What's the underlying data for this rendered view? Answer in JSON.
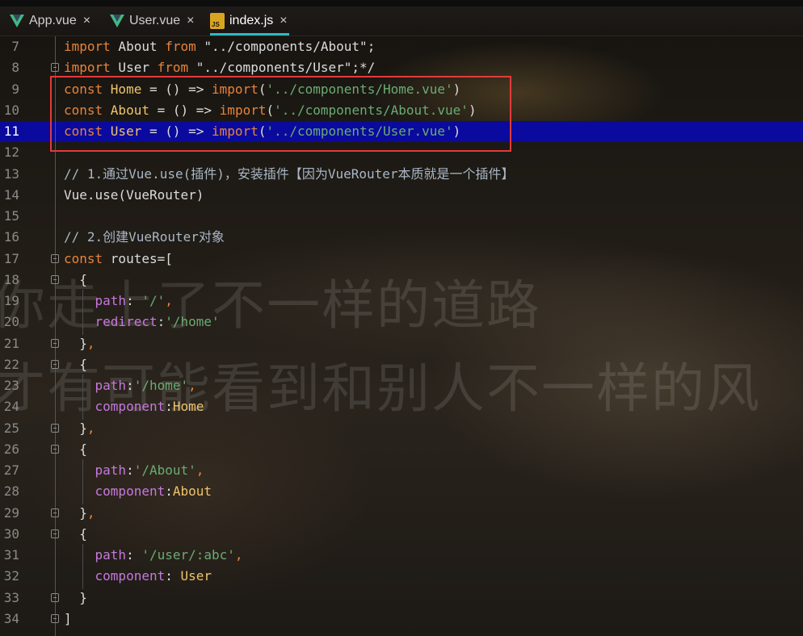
{
  "tabs": [
    {
      "name": "App.vue",
      "close": "×"
    },
    {
      "name": "User.vue",
      "close": "×"
    },
    {
      "name": "index.js",
      "close": "×",
      "active": true,
      "badge": "JS"
    }
  ],
  "watermark": {
    "line1": "你走上了不一样的道路",
    "line2": "才有可能看到和别人不一样的风"
  },
  "colors": {
    "keyword": "#e8833a",
    "identifier": "#efc46b",
    "string": "#6aab73",
    "property": "#c679dd",
    "highlight": "#0a0a9e",
    "annotation_box": "#e23b3b",
    "tab_accent": "#2fb8c8"
  },
  "editor": {
    "current_line": "11",
    "lines": [
      {
        "no": "7",
        "tokens": [
          [
            "kw",
            "import"
          ],
          [
            "plain",
            " About "
          ],
          [
            "kw",
            "from"
          ],
          [
            "plain",
            " \"../components/About\";"
          ]
        ]
      },
      {
        "no": "8",
        "tokens": [
          [
            "kw",
            "import"
          ],
          [
            "plain",
            " User "
          ],
          [
            "kw",
            "from"
          ],
          [
            "plain",
            " \"../components/User\";*/"
          ]
        ]
      },
      {
        "no": "9",
        "tokens": [
          [
            "kw",
            "const "
          ],
          [
            "id",
            "Home"
          ],
          [
            "plain",
            " = () => "
          ],
          [
            "kw",
            "import"
          ],
          [
            "plain",
            "("
          ],
          [
            "str",
            "'../components/Home.vue'"
          ],
          [
            "plain",
            ")"
          ]
        ]
      },
      {
        "no": "10",
        "tokens": [
          [
            "kw",
            "const "
          ],
          [
            "id",
            "About"
          ],
          [
            "plain",
            " = () => "
          ],
          [
            "kw",
            "import"
          ],
          [
            "plain",
            "("
          ],
          [
            "str",
            "'../components/About.vue'"
          ],
          [
            "plain",
            ")"
          ]
        ]
      },
      {
        "no": "11",
        "tokens": [
          [
            "kw",
            "const "
          ],
          [
            "id",
            "User"
          ],
          [
            "plain",
            " = () => "
          ],
          [
            "kw",
            "import"
          ],
          [
            "plain",
            "("
          ],
          [
            "str",
            "'../components/User.vue'"
          ],
          [
            "plain",
            ")"
          ]
        ]
      },
      {
        "no": "12",
        "tokens": []
      },
      {
        "no": "13",
        "tokens": [
          [
            "cmt",
            "// 1.通过Vue.use(插件)，安装插件【因为VueRouter本质就是一个插件】"
          ]
        ]
      },
      {
        "no": "14",
        "tokens": [
          [
            "plain",
            "Vue.use(VueRouter)"
          ]
        ]
      },
      {
        "no": "15",
        "tokens": []
      },
      {
        "no": "16",
        "tokens": [
          [
            "cmt",
            "// 2.创建VueRouter对象"
          ]
        ]
      },
      {
        "no": "17",
        "tokens": [
          [
            "kw",
            "const "
          ],
          [
            "plain",
            "routes=["
          ]
        ]
      },
      {
        "no": "18",
        "tokens": [
          [
            "plain",
            "  {"
          ]
        ]
      },
      {
        "no": "19",
        "tokens": [
          [
            "plain",
            "    "
          ],
          [
            "prop",
            "path"
          ],
          [
            "plain",
            ": "
          ],
          [
            "str",
            "'/'"
          ],
          [
            "kw",
            ","
          ]
        ]
      },
      {
        "no": "20",
        "tokens": [
          [
            "plain",
            "    "
          ],
          [
            "prop",
            "redirect"
          ],
          [
            "plain",
            ":"
          ],
          [
            "str",
            "'/home'"
          ]
        ]
      },
      {
        "no": "21",
        "tokens": [
          [
            "plain",
            "  }"
          ],
          [
            "kw",
            ","
          ]
        ]
      },
      {
        "no": "22",
        "tokens": [
          [
            "plain",
            "  {"
          ]
        ]
      },
      {
        "no": "23",
        "tokens": [
          [
            "plain",
            "    "
          ],
          [
            "prop",
            "path"
          ],
          [
            "plain",
            ":"
          ],
          [
            "str",
            "'/home'"
          ],
          [
            "kw",
            ","
          ]
        ]
      },
      {
        "no": "24",
        "tokens": [
          [
            "plain",
            "    "
          ],
          [
            "prop",
            "component"
          ],
          [
            "plain",
            ":"
          ],
          [
            "id",
            "Home"
          ]
        ]
      },
      {
        "no": "25",
        "tokens": [
          [
            "plain",
            "  }"
          ],
          [
            "kw",
            ","
          ]
        ]
      },
      {
        "no": "26",
        "tokens": [
          [
            "plain",
            "  {"
          ]
        ]
      },
      {
        "no": "27",
        "tokens": [
          [
            "plain",
            "    "
          ],
          [
            "prop",
            "path"
          ],
          [
            "plain",
            ":"
          ],
          [
            "str",
            "'/About'"
          ],
          [
            "kw",
            ","
          ]
        ]
      },
      {
        "no": "28",
        "tokens": [
          [
            "plain",
            "    "
          ],
          [
            "prop",
            "component"
          ],
          [
            "plain",
            ":"
          ],
          [
            "id",
            "About"
          ]
        ]
      },
      {
        "no": "29",
        "tokens": [
          [
            "plain",
            "  }"
          ],
          [
            "kw",
            ","
          ]
        ]
      },
      {
        "no": "30",
        "tokens": [
          [
            "plain",
            "  {"
          ]
        ]
      },
      {
        "no": "31",
        "tokens": [
          [
            "plain",
            "    "
          ],
          [
            "prop",
            "path"
          ],
          [
            "plain",
            ": "
          ],
          [
            "str",
            "'/user/:abc'"
          ],
          [
            "kw",
            ","
          ]
        ]
      },
      {
        "no": "32",
        "tokens": [
          [
            "plain",
            "    "
          ],
          [
            "prop",
            "component"
          ],
          [
            "plain",
            ": "
          ],
          [
            "id",
            "User"
          ]
        ]
      },
      {
        "no": "33",
        "tokens": [
          [
            "plain",
            "  }"
          ]
        ]
      },
      {
        "no": "34",
        "tokens": [
          [
            "plain",
            "]"
          ]
        ]
      }
    ]
  }
}
